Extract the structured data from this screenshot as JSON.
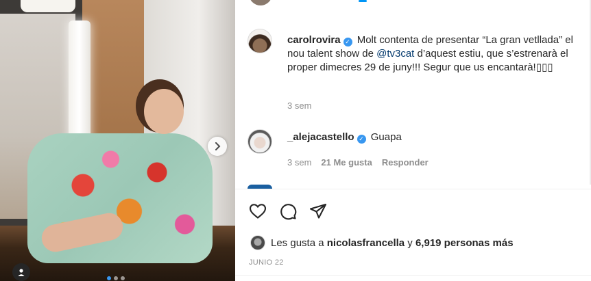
{
  "post": {
    "carousel": {
      "slide_count": 3,
      "active_slide": 1
    }
  },
  "caption": {
    "username": "carolrovira",
    "text_before": "Molt contenta de presentar “La gran vetllada” el nou talent show de ",
    "mention": "@tv3cat",
    "text_after": " d’aquest estiu, que s’estrenarà el proper dimecres 29 de juny!!! Segur que us encantarà!",
    "emoji": "▯▯▯",
    "time": "3 sem"
  },
  "comments": [
    {
      "username": "_alejacastello",
      "text": "Guapa",
      "time": "3 sem",
      "likes": "21 Me gusta",
      "reply": "Responder"
    }
  ],
  "likes": {
    "prefix": "Les gusta a",
    "user": "nicolasfrancella",
    "middle": "y",
    "count": "6,919 personas más"
  },
  "date": "JUNIO 22",
  "colors": {
    "verified": "#3897f0",
    "mention": "#00376b",
    "muted": "#8e8e8e",
    "text": "#262626"
  },
  "icons": [
    "chevron-right-icon",
    "person-tag-icon",
    "heart-icon",
    "comment-icon",
    "share-icon",
    "verified-icon"
  ]
}
